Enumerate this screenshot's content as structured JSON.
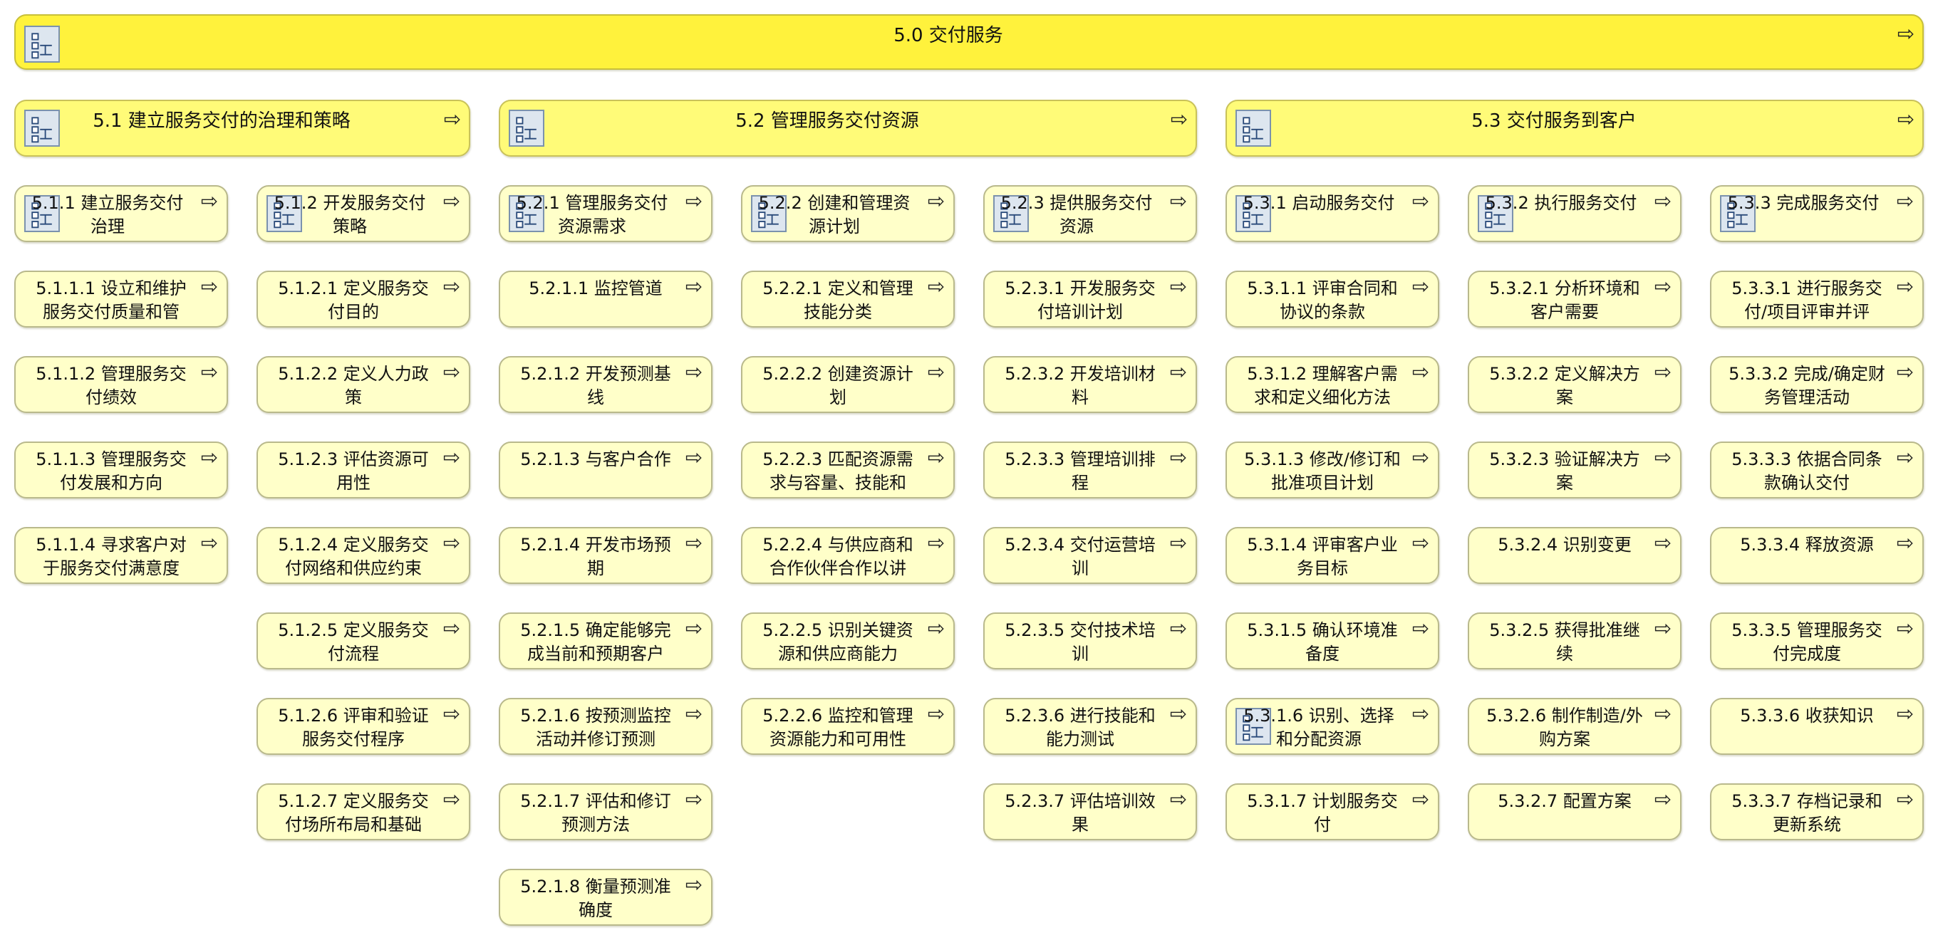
{
  "diagram": {
    "root": {
      "label": "5.0 交付服务",
      "has_submodel": true
    },
    "level1": [
      {
        "label": "5.1 建立服务交付的治理和策略",
        "has_submodel": true
      },
      {
        "label": "5.2 管理服务交付资源",
        "has_submodel": true
      },
      {
        "label": "5.3 交付服务到客户",
        "has_submodel": true
      }
    ],
    "level2": [
      {
        "label": "5.1.1 建立服务交付治理",
        "has_submodel": true
      },
      {
        "label": "5.1.2 开发服务交付策略",
        "has_submodel": true
      },
      {
        "label": "5.2.1 管理服务交付资源需求",
        "has_submodel": true
      },
      {
        "label": "5.2.2 创建和管理资源计划",
        "has_submodel": true
      },
      {
        "label": "5.2.3 提供服务交付资源",
        "has_submodel": true
      },
      {
        "label": "5.3.1 启动服务交付",
        "has_submodel": true
      },
      {
        "label": "5.3.2 执行服务交付",
        "has_submodel": true
      },
      {
        "label": "5.3.3 完成服务交付",
        "has_submodel": true
      }
    ],
    "columns": [
      {
        "items": [
          {
            "label": "5.1.1.1 设立和维护服务交付质量和管"
          },
          {
            "label": "5.1.1.2 管理服务交付绩效"
          },
          {
            "label": "5.1.1.3 管理服务交付发展和方向"
          },
          {
            "label": "5.1.1.4 寻求客户对于服务交付满意度"
          }
        ]
      },
      {
        "items": [
          {
            "label": "5.1.2.1 定义服务交付目的"
          },
          {
            "label": "5.1.2.2 定义人力政策"
          },
          {
            "label": "5.1.2.3 评估资源可用性"
          },
          {
            "label": "5.1.2.4 定义服务交付网络和供应约束"
          },
          {
            "label": "5.1.2.5 定义服务交付流程"
          },
          {
            "label": "5.1.2.6 评审和验证服务交付程序"
          },
          {
            "label": "5.1.2.7 定义服务交付场所布局和基础"
          }
        ]
      },
      {
        "items": [
          {
            "label": "5.2.1.1 监控管道"
          },
          {
            "label": "5.2.1.2 开发预测基线"
          },
          {
            "label": "5.2.1.3 与客户合作"
          },
          {
            "label": "5.2.1.4 开发市场预期"
          },
          {
            "label": "5.2.1.5 确定能够完成当前和预期客户"
          },
          {
            "label": "5.2.1.6 按预测监控活动并修订预测"
          },
          {
            "label": "5.2.1.7 评估和修订预测方法"
          },
          {
            "label": "5.2.1.8 衡量预测准确度"
          }
        ]
      },
      {
        "items": [
          {
            "label": "5.2.2.1 定义和管理技能分类"
          },
          {
            "label": "5.2.2.2 创建资源计划"
          },
          {
            "label": "5.2.2.3 匹配资源需求与容量、技能和"
          },
          {
            "label": "5.2.2.4 与供应商和合作伙伴合作以讲"
          },
          {
            "label": "5.2.2.5 识别关键资源和供应商能力"
          },
          {
            "label": "5.2.2.6 监控和管理资源能力和可用性"
          }
        ]
      },
      {
        "items": [
          {
            "label": "5.2.3.1 开发服务交付培训计划"
          },
          {
            "label": "5.2.3.2 开发培训材料"
          },
          {
            "label": "5.2.3.3 管理培训排程"
          },
          {
            "label": "5.2.3.4 交付运营培训"
          },
          {
            "label": "5.2.3.5 交付技术培训"
          },
          {
            "label": "5.2.3.6 进行技能和能力测试"
          },
          {
            "label": "5.2.3.7 评估培训效果"
          }
        ]
      },
      {
        "items": [
          {
            "label": "5.3.1.1 评审合同和协议的条款"
          },
          {
            "label": "5.3.1.2 理解客户需求和定义细化方法"
          },
          {
            "label": "5.3.1.3 修改/修订和批准项目计划"
          },
          {
            "label": "5.3.1.4 评审客户业务目标"
          },
          {
            "label": "5.3.1.5 确认环境准备度"
          },
          {
            "label": "5.3.1.6 识别、选择和分配资源",
            "has_submodel": true
          },
          {
            "label": "5.3.1.7 计划服务交付"
          }
        ]
      },
      {
        "items": [
          {
            "label": "5.3.2.1 分析环境和客户需要"
          },
          {
            "label": "5.3.2.2 定义解决方案"
          },
          {
            "label": "5.3.2.3 验证解决方案"
          },
          {
            "label": "5.3.2.4 识别变更"
          },
          {
            "label": "5.3.2.5 获得批准继续"
          },
          {
            "label": "5.3.2.6 制作制造/外购方案"
          },
          {
            "label": "5.3.2.7 配置方案"
          }
        ]
      },
      {
        "items": [
          {
            "label": "5.3.3.1 进行服务交付/项目评审并评"
          },
          {
            "label": "5.3.3.2 完成/确定财务管理活动"
          },
          {
            "label": "5.3.3.3 依据合同条款确认交付"
          },
          {
            "label": "5.3.3.4 释放资源"
          },
          {
            "label": "5.3.3.5 管理服务交付完成度"
          },
          {
            "label": "5.3.3.6 收获知识"
          },
          {
            "label": "5.3.3.7 存档记录和更新系统"
          }
        ]
      }
    ],
    "icons": {
      "submodel": "hierarchy-icon",
      "drill": "drill-down-arrow-icon"
    },
    "colors": {
      "root_fill": "#fff23c",
      "level1_fill": "#fffb78",
      "leaf_fill": "#ffffc9",
      "border": "#b9b98c"
    }
  }
}
